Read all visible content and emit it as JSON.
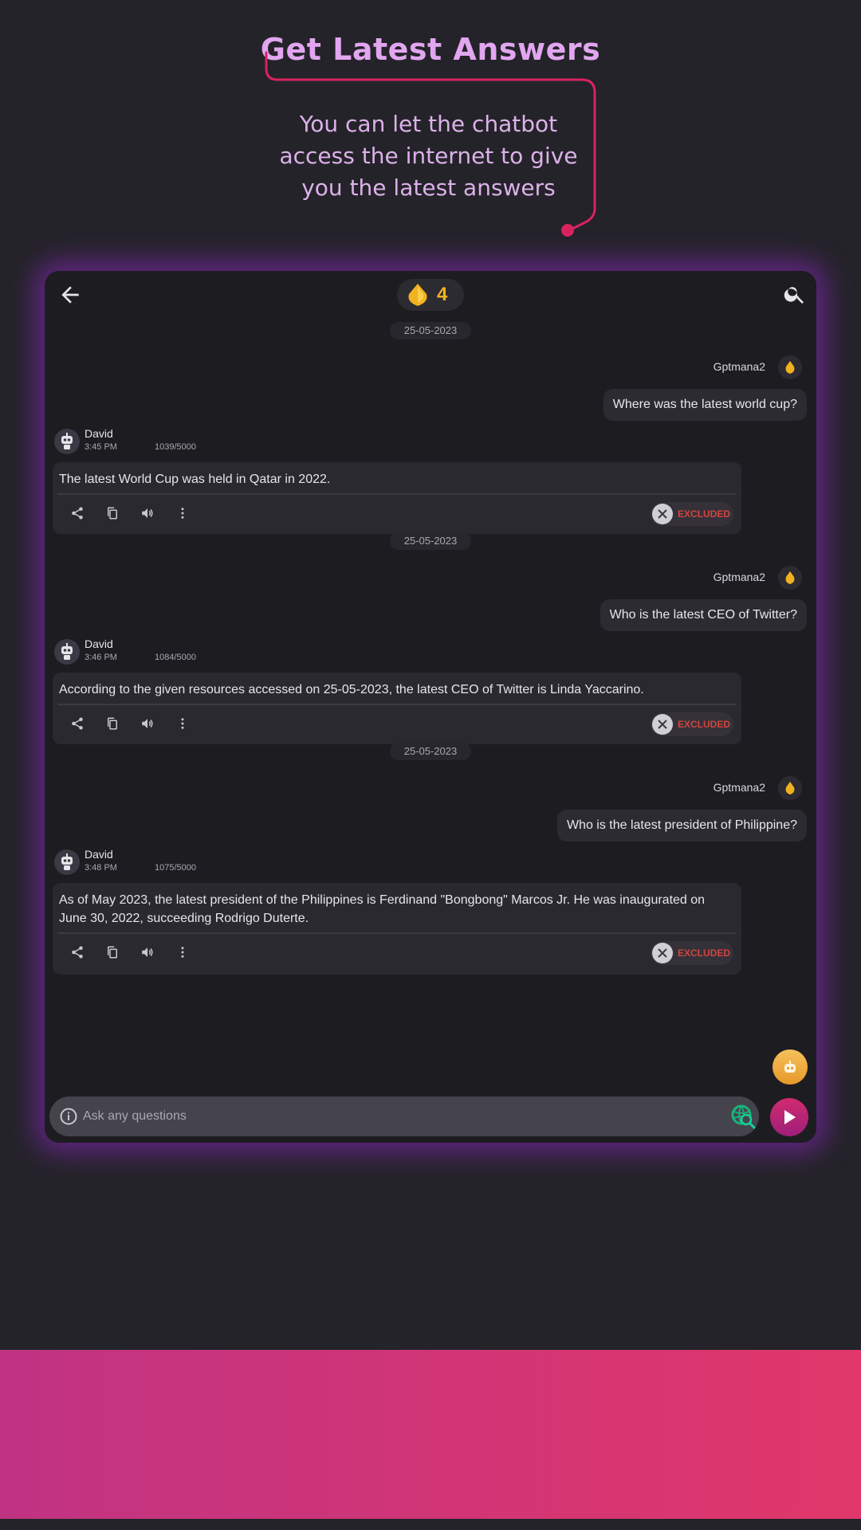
{
  "promo": {
    "title": "Get Latest Answers",
    "subtitle": "You can let the chatbot access the internet to give you the latest answers"
  },
  "topbar": {
    "credits": "4",
    "back_icon": "arrow-back-icon",
    "search_icon": "search-icon"
  },
  "messages": [
    {
      "date": "25-05-2023",
      "sender": "Gptmana2",
      "question": "Where was the latest world cup?",
      "bot_name": "David",
      "time": "3:45 PM",
      "count": "1039/5000",
      "answer": "The latest World Cup was held in Qatar in 2022.",
      "status": "EXCLUDED"
    },
    {
      "date": "25-05-2023",
      "sender": "Gptmana2",
      "question": "Who is the latest CEO of Twitter?",
      "bot_name": "David",
      "time": "3:46 PM",
      "count": "1084/5000",
      "answer": "According to the given resources accessed on 25-05-2023, the latest CEO of Twitter is Linda Yaccarino.",
      "status": "EXCLUDED"
    },
    {
      "date": "25-05-2023",
      "sender": "Gptmana2",
      "question": "Who is the latest president of Philippine?",
      "bot_name": "David",
      "time": "3:48 PM",
      "count": "1075/5000",
      "answer": "As of May 2023, the latest president of the Philippines is Ferdinand \"Bongbong\" Marcos Jr. He was inaugurated on June 30, 2022, succeeding Rodrigo Duterte.",
      "status": "EXCLUDED"
    }
  ],
  "composer": {
    "placeholder": "Ask any questions"
  },
  "colors": {
    "accent_pink": "#d12b6f",
    "credit_gold": "#f2b21f",
    "excluded_red": "#d0453f",
    "glow_purple": "#9628d2"
  }
}
